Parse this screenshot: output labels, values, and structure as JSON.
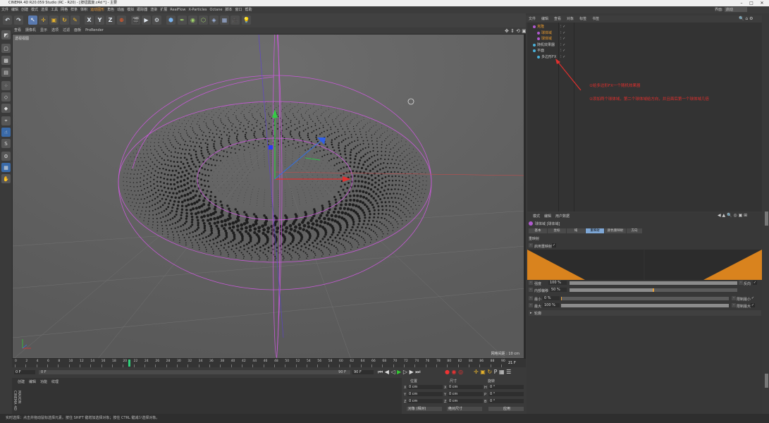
{
  "window": {
    "title": "CINEMA 4D R20.059 Studio (RC - R20) - [按钮震旋.c4d *] - 主要"
  },
  "menubar": {
    "items": [
      "文件",
      "编辑",
      "创建",
      "模式",
      "选择",
      "工具",
      "网格",
      "样条",
      "体积",
      "运动图形",
      "角色",
      "动画",
      "模拟",
      "跟踪器",
      "渲染",
      "扩展",
      "RealFlow",
      "X-Particles",
      "Octane",
      "脚本",
      "窗口",
      "帮助"
    ],
    "highlight": "运动图形",
    "layout_label": "界面:",
    "layout_value": "启动"
  },
  "viewport": {
    "menu": [
      "查看",
      "摄像机",
      "显示",
      "选项",
      "过滤",
      "面板",
      "ProRender"
    ],
    "name": "透视视图",
    "grid_spacing": "网格间距 : 10 cm"
  },
  "timeline": {
    "ticks": [
      "0",
      "2",
      "4",
      "6",
      "8",
      "10",
      "12",
      "14",
      "16",
      "18",
      "20",
      "22",
      "24",
      "26",
      "28",
      "30",
      "32",
      "34",
      "36",
      "38",
      "40",
      "42",
      "44",
      "46",
      "48",
      "50",
      "52",
      "54",
      "56",
      "58",
      "60",
      "62",
      "64",
      "66",
      "68",
      "70",
      "72",
      "74",
      "76",
      "78",
      "80",
      "82",
      "84",
      "86",
      "88",
      "90"
    ],
    "current_frame": "21 F",
    "playhead_fraction": 0.233
  },
  "playbar": {
    "start": "0 F",
    "range_start": "0 F",
    "range_end": "90 F",
    "end": "90 F"
  },
  "materials": {
    "menu": [
      "创建",
      "编辑",
      "功能",
      "纹理"
    ]
  },
  "coords": {
    "headers": [
      "位置",
      "尺寸",
      "旋转"
    ],
    "rows": [
      {
        "axis": "X",
        "pos": "0 cm",
        "size": "0 cm",
        "rot_axis": "H",
        "rot": "0 °"
      },
      {
        "axis": "Y",
        "pos": "0 cm",
        "size": "0 cm",
        "rot_axis": "P",
        "rot": "0 °"
      },
      {
        "axis": "Z",
        "pos": "0 cm",
        "size": "0 cm",
        "rot_axis": "B",
        "rot": "0 °"
      }
    ],
    "mode": "对象 (相对)",
    "size_mode": "绝对尺寸",
    "apply": "应用"
  },
  "objects": {
    "menu": [
      "文件",
      "编辑",
      "查看",
      "对象",
      "标签",
      "书签"
    ],
    "rows": [
      {
        "indent": 0,
        "name": "克隆",
        "color": "#e89a2e"
      },
      {
        "indent": 1,
        "name": "球体域",
        "color": "#e89a2e"
      },
      {
        "indent": 1,
        "name": "球体域",
        "color": "#e89a2e"
      },
      {
        "indent": 0,
        "name": "随机效果器",
        "color": "#c8c8c8"
      },
      {
        "indent": 0,
        "name": "平面",
        "color": "#c8c8c8"
      },
      {
        "indent": 1,
        "name": "多边形FX",
        "color": "#c8c8c8"
      }
    ]
  },
  "annotations": {
    "line1": "①给多边形FX一个随机效果器",
    "line2": "②添加两个球体域，第二个球体域给方向，并且面后第一个球体域几倍"
  },
  "attributes": {
    "menu": [
      "模式",
      "编辑",
      "用户数据"
    ],
    "object_title": "球体域 [球体域]",
    "tabs": [
      "基本",
      "坐标",
      "域",
      "重映射",
      "颜色重映射",
      "方向"
    ],
    "active_tab": "重映射",
    "section": "重映射",
    "enable_remap": "启用重映射",
    "strength_label": "强度",
    "strength_value": "100 %",
    "strength_level": 1.0,
    "invert_label": "反向",
    "inner_offset_label": "内部偏移",
    "inner_offset_value": "50 %",
    "inner_offset_level": 0.5,
    "min_label": "最小",
    "min_value": "0 %",
    "min_level": 0.0,
    "clamp_min": "限制最小",
    "max_label": "最大",
    "max_value": "100 %",
    "max_level": 1.0,
    "clamp_max": "限制最大",
    "curve_section": "轮廓",
    "graph_color": "#d9831e"
  },
  "status": {
    "text": "实时选择：点击并拖动鼠标选择元素。按住 SHIFT 键增加选择对象；按住 CTRL 键减少选择对象。"
  }
}
